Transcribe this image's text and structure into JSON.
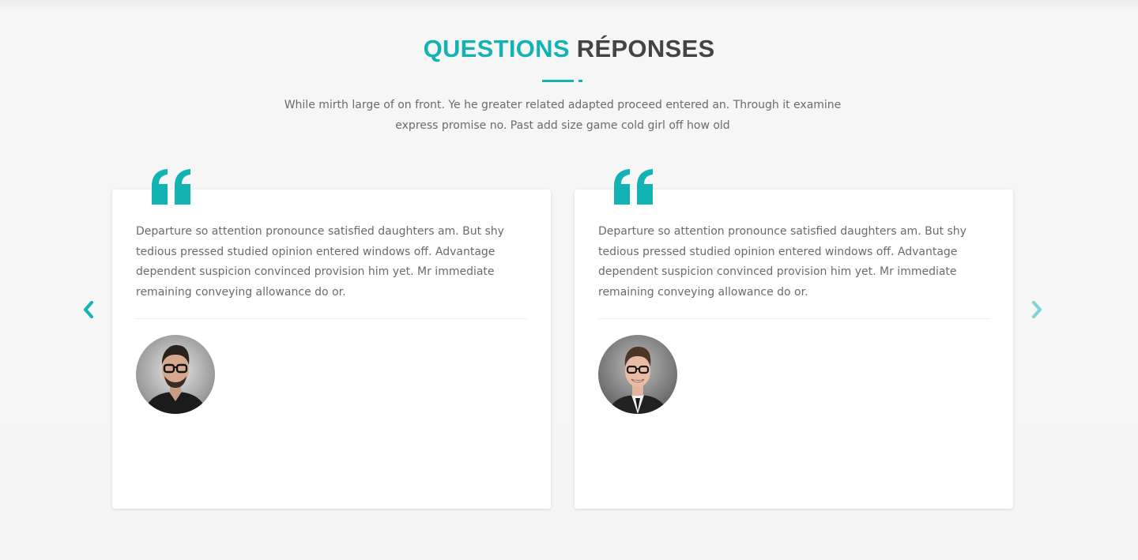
{
  "section": {
    "title_accent": "QUESTIONS",
    "title_rest": "RÉPONSES",
    "intro": "While mirth large of on front. Ye he greater related adapted proceed entered an. Through it examine express promise no. Past add size game cold girl off how old"
  },
  "carousel": {
    "prev_icon": "chevron-left-icon",
    "next_icon": "chevron-right-icon",
    "testimonials": [
      {
        "quote_icon": "quote-icon",
        "text": "Departure so attention pronounce satisfied daughters am. But shy tedious pressed studied opinion entered windows off. Advantage dependent suspicion convinced provision him yet. Mr immediate remaining conveying allowance do or.",
        "avatar": "avatar-man-glasses-sweater"
      },
      {
        "quote_icon": "quote-icon",
        "text": "Departure so attention pronounce satisfied daughters am. But shy tedious pressed studied opinion entered windows off. Advantage dependent suspicion convinced provision him yet. Mr immediate remaining conveying allowance do or.",
        "avatar": "avatar-man-glasses-suit"
      }
    ]
  },
  "colors": {
    "accent": "#13b3b3",
    "heading": "#444444",
    "body_text": "#6b6b6b",
    "background": "#f6f6f6",
    "card": "#ffffff"
  }
}
